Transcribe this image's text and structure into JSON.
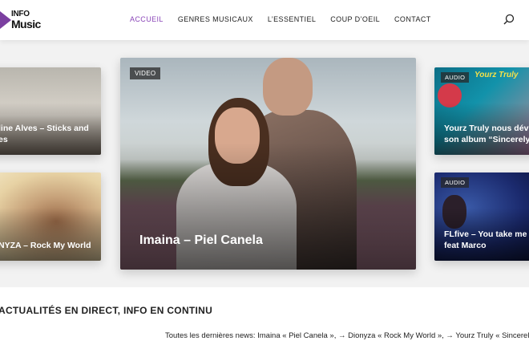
{
  "logo": {
    "line1": "INFO",
    "line2": "Music"
  },
  "nav": {
    "items": [
      {
        "label": "ACCUEIL",
        "active": true
      },
      {
        "label": "GENRES MUSICAUX",
        "active": false
      },
      {
        "label": "L’ESSENTIEL",
        "active": false
      },
      {
        "label": "COUP D’OEIL",
        "active": false
      },
      {
        "label": "CONTACT",
        "active": false
      }
    ]
  },
  "search_icon": "search-icon",
  "cards": {
    "left_top": {
      "title": "line Alves – Sticks and\nes",
      "badge": ""
    },
    "left_bottom": {
      "title": "NYZA – Rock My World",
      "badge": ""
    },
    "center": {
      "title": "Imaina – Piel Canela",
      "badge": "VIDEO"
    },
    "right_top": {
      "title": "Yourz Truly nous dév\nson album “Sincerely",
      "badge": "AUDIO",
      "overlay_text": "Yourz Truly"
    },
    "right_bottom": {
      "title": "FLfive – You take me\nfeat Marco",
      "badge": "AUDIO"
    }
  },
  "section": {
    "heading": "ACTUALITÉS EN DIRECT, INFO EN CONTINU",
    "ticker": "Toutes les dernières news: Imaina « Piel Canela », → Dionyza « Rock My World », → Yourz Truly « Sincerely"
  },
  "colors": {
    "accent": "#8a45b8",
    "logo": "#7b3fa0"
  }
}
